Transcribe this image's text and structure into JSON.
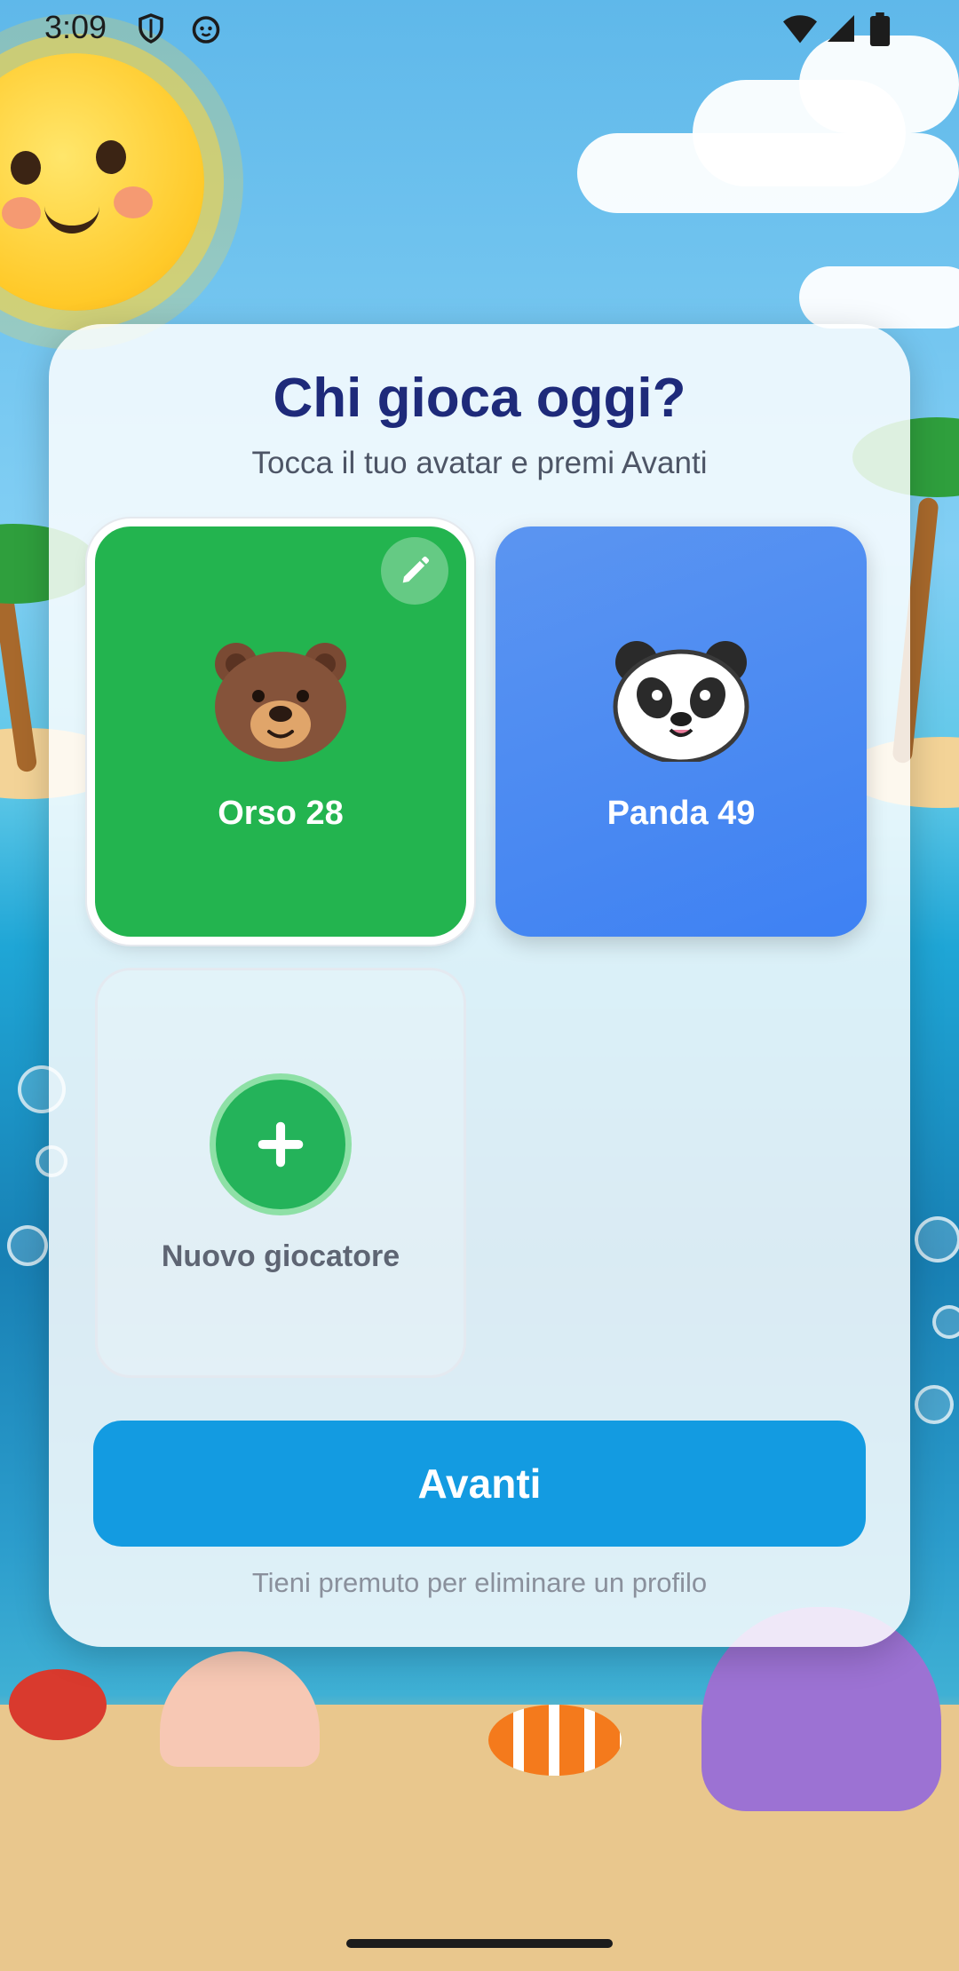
{
  "status_bar": {
    "time": "3:09",
    "icons": [
      "shield-icon",
      "face-icon",
      "wifi-icon",
      "signal-icon",
      "battery-icon"
    ]
  },
  "screen": {
    "title": "Chi gioca oggi?",
    "subtitle": "Tocca il tuo avatar e premi Avanti",
    "profiles": [
      {
        "name": "Orso 28",
        "avatar": "bear-icon",
        "color": "#23b44f",
        "selected": true,
        "edit_icon": "pencil-icon"
      },
      {
        "name": "Panda 49",
        "avatar": "panda-icon",
        "color": "#4286f3",
        "selected": false
      }
    ],
    "new_player": {
      "label": "Nuovo giocatore",
      "icon": "plus-icon"
    },
    "next_button": "Avanti",
    "hint": "Tieni premuto per eliminare un profilo"
  },
  "colors": {
    "title": "#1e2a7a",
    "primary_button": "#139be1",
    "selected_profile": "#23b44f",
    "second_profile": "#4286f3"
  }
}
